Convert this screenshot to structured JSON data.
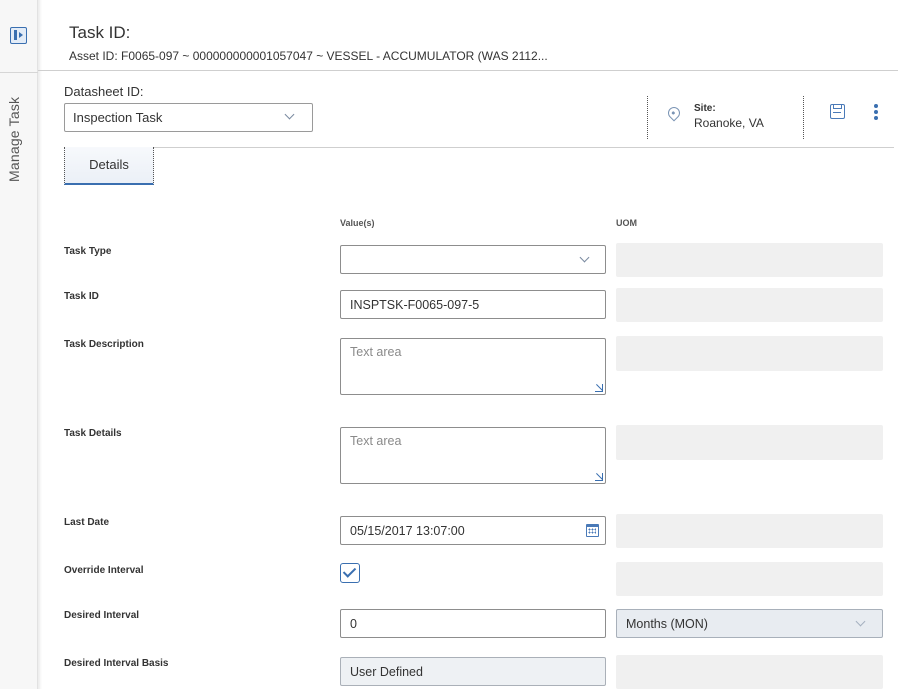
{
  "side_panel": {
    "label": "Manage Task"
  },
  "header": {
    "title": "Task ID:",
    "asset_line": "Asset ID: F0065-097 ~ 000000000001057047 ~ VESSEL - ACCUMULATOR (WAS 2112..."
  },
  "datasheet": {
    "label": "Datasheet ID:",
    "selected": "Inspection Task"
  },
  "site": {
    "label": "Site:",
    "value": "Roanoke, VA"
  },
  "tabs": [
    {
      "label": "Details",
      "active": true
    }
  ],
  "columns": {
    "values": "Value(s)",
    "uom": "UOM"
  },
  "fields": {
    "task_type": {
      "label": "Task Type",
      "value": ""
    },
    "task_id": {
      "label": "Task ID",
      "value": "INSPTSK-F0065-097-5"
    },
    "task_description": {
      "label": "Task Description",
      "placeholder": "Text area"
    },
    "task_details": {
      "label": "Task Details",
      "placeholder": "Text area"
    },
    "last_date": {
      "label": "Last Date",
      "value": "05/15/2017 13:07:00"
    },
    "override_interval": {
      "label": "Override Interval",
      "checked": true
    },
    "desired_interval": {
      "label": "Desired Interval",
      "value": "0",
      "uom": "Months (MON)"
    },
    "desired_interval_basis": {
      "label": "Desired Interval Basis",
      "value": "User Defined"
    }
  },
  "colors": {
    "accent": "#3a6fb0",
    "border": "#8d8d8d",
    "readonly_bg": "#f0f0f0"
  },
  "icons": [
    "panel-toggle-icon",
    "location-pin-icon",
    "save-icon",
    "more-options-icon",
    "chevron-down-icon",
    "resize-icon",
    "calendar-icon",
    "checkmark-icon"
  ]
}
